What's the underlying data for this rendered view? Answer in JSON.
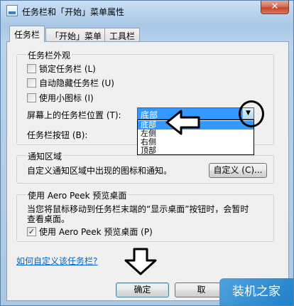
{
  "window": {
    "title": "任务栏和「开始」菜单属性",
    "close_glyph": "✕",
    "icon": "taskbar-properties-icon"
  },
  "tabs": [
    {
      "label": "任务栏",
      "active": true
    },
    {
      "label": "「开始」菜单",
      "active": false
    },
    {
      "label": "工具栏",
      "active": false
    }
  ],
  "appearance": {
    "title": "任务栏外观",
    "checkboxes": [
      {
        "label": "锁定任务栏 (L)",
        "checked": false
      },
      {
        "label": "自动隐藏任务栏 (U)",
        "checked": false
      },
      {
        "label": "使用小图标 (I)",
        "checked": false
      }
    ],
    "position_label": "屏幕上的任务栏位置 (T):",
    "position_value": "底部",
    "position_options": [
      "底部",
      "左侧",
      "右侧",
      "顶部"
    ],
    "buttons_label": "任务栏按钮 (B):"
  },
  "notification": {
    "title": "通知区域",
    "description": "自定义通知区域中出现的图标和通知。",
    "customize_label": "自定义 (C)..."
  },
  "aero_peek": {
    "title": "使用 Aero Peek 预览桌面",
    "description_line1": "当您将鼠标移动到任务栏末端的“显示桌面”按钮时，会暂时",
    "description_line2": "查看桌面。",
    "checkbox_label": "使用 Aero Peek 预览桌面 (P)",
    "checked": true,
    "check_glyph": "✓"
  },
  "help_link": "如何自定义该任务栏?",
  "footer": {
    "ok_label": "确定",
    "cancel_label": "取"
  },
  "watermark": "装机之家",
  "colors": {
    "selection": "#3399ff",
    "link": "#0066cc",
    "annotation": "#000000"
  }
}
